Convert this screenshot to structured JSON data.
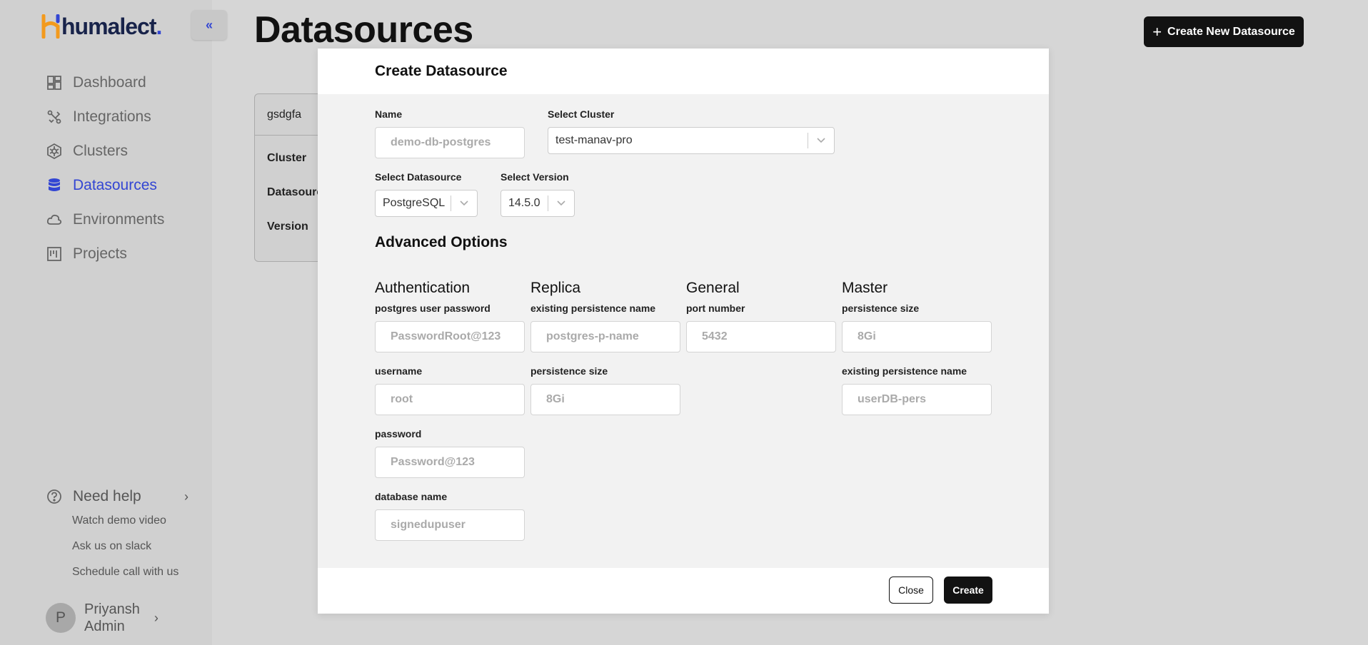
{
  "brand": {
    "name": "humalect",
    "dot": "."
  },
  "sidebar": {
    "items": [
      {
        "label": "Dashboard",
        "icon": "dashboard-icon"
      },
      {
        "label": "Integrations",
        "icon": "integrations-icon"
      },
      {
        "label": "Clusters",
        "icon": "clusters-icon"
      },
      {
        "label": "Datasources",
        "icon": "database-icon",
        "active": true
      },
      {
        "label": "Environments",
        "icon": "cloud-icon"
      },
      {
        "label": "Projects",
        "icon": "projects-icon"
      }
    ],
    "help": {
      "title": "Need help",
      "links": [
        "Watch demo video",
        "Ask us on slack",
        "Schedule call with us"
      ]
    },
    "user": {
      "initial": "P",
      "name": "Priyansh",
      "role": "Admin"
    }
  },
  "main": {
    "title": "Datasources",
    "create_button": "Create New Datasource",
    "card": {
      "name": "gsdgfa",
      "rows": [
        "Cluster",
        "Datasource",
        "Version"
      ]
    }
  },
  "modal": {
    "title": "Create Datasource",
    "name": {
      "label": "Name",
      "placeholder": "demo-db-postgres"
    },
    "cluster": {
      "label": "Select Cluster",
      "value": "test-manav-pro"
    },
    "datasource": {
      "label": "Select Datasource",
      "value": "PostgreSQL"
    },
    "version": {
      "label": "Select Version",
      "value": "14.5.0"
    },
    "advanced_title": "Advanced Options",
    "authentication": {
      "title": "Authentication",
      "postgres_password": {
        "label": "postgres user password",
        "placeholder": "PasswordRoot@123"
      },
      "username": {
        "label": "username",
        "placeholder": "root"
      },
      "password": {
        "label": "password",
        "placeholder": "Password@123"
      },
      "database_name": {
        "label": "database name",
        "placeholder": "signedupuser"
      }
    },
    "replica": {
      "title": "Replica",
      "existing_persistence_name": {
        "label": "existing persistence name",
        "placeholder": "postgres-p-name"
      },
      "persistence_size": {
        "label": "persistence size",
        "placeholder": "8Gi"
      }
    },
    "general": {
      "title": "General",
      "port_number": {
        "label": "port number",
        "placeholder": "5432"
      }
    },
    "master": {
      "title": "Master",
      "persistence_size": {
        "label": "persistence size",
        "placeholder": "8Gi"
      },
      "existing_persistence_name": {
        "label": "existing persistence name",
        "placeholder": "userDB-pers"
      }
    },
    "close_button": "Close",
    "create_button": "Create"
  },
  "colors": {
    "accent": "#3346d3",
    "dark_button": "#121212",
    "overlay": "#d6d6d6"
  }
}
